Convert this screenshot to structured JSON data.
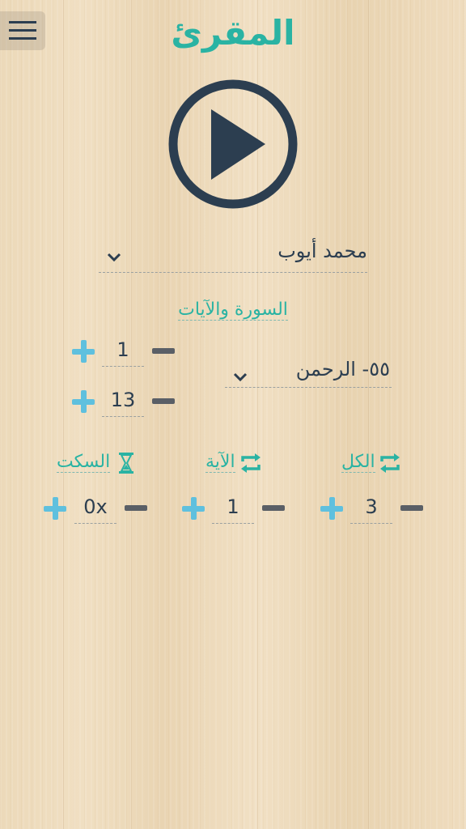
{
  "app": {
    "title": "المقرئ"
  },
  "icons": {
    "menu": "hamburger-menu-icon",
    "play": "play-circle-icon",
    "repeat": "repeat-icon",
    "pause": "hourglass-icon",
    "dropdown": "chevron-down-icon"
  },
  "colors": {
    "accent": "#2ab3a3",
    "plus": "#5fc0de",
    "minus": "#5a5f66",
    "text": "#2c3e50"
  },
  "reciter": {
    "selected": "محمد أيوب"
  },
  "surah_section": {
    "label": "السورة والآيات",
    "surah": {
      "selected": "٥٥- الرحمن"
    },
    "ayah_from": "1",
    "ayah_to": "13"
  },
  "repeat_controls": {
    "all": {
      "label": "الكل",
      "value": "3"
    },
    "ayah": {
      "label": "الآية",
      "value": "1"
    },
    "pause": {
      "label": "السكت",
      "value": "0x"
    }
  }
}
